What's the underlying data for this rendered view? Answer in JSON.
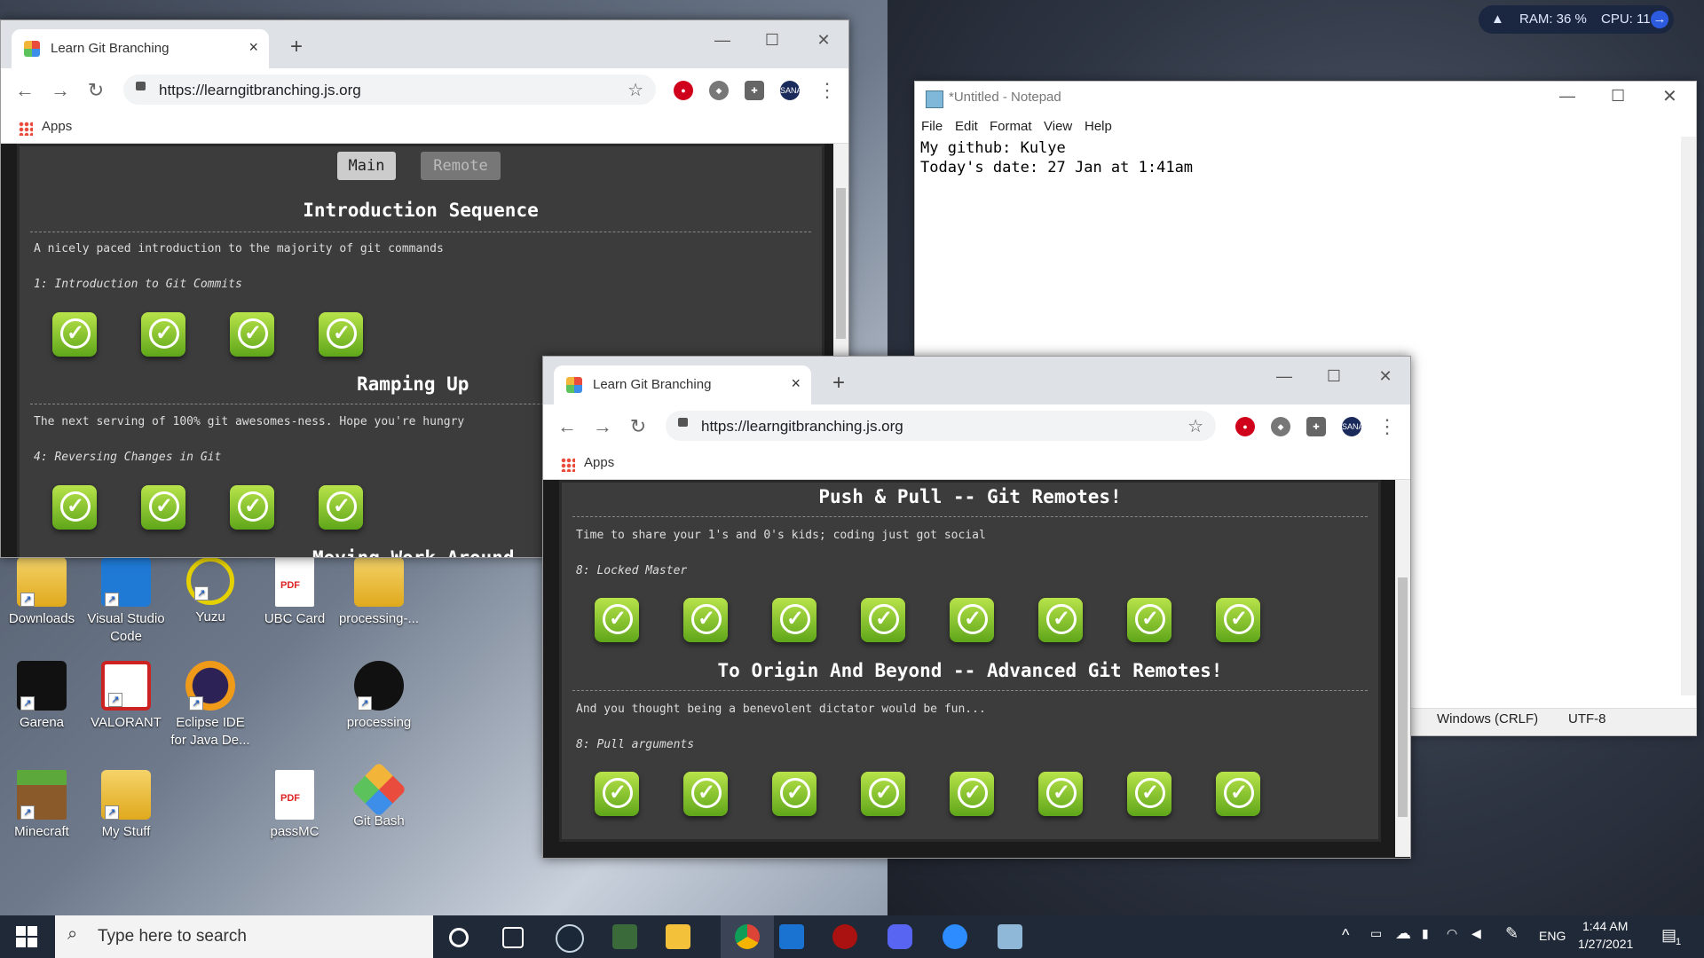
{
  "system_monitor": {
    "ram": "RAM: 36 %",
    "cpu": "CPU: 11 %"
  },
  "desktop_icons": [
    {
      "label": "Downloads"
    },
    {
      "label": "Visual Studio Code"
    },
    {
      "label": "Yuzu"
    },
    {
      "label": "UBC Card"
    },
    {
      "label": "processing-..."
    },
    {
      "label": "Garena"
    },
    {
      "label": "VALORANT"
    },
    {
      "label": "Eclipse IDE for Java De..."
    },
    {
      "label": "processing"
    },
    {
      "label": "Minecraft"
    },
    {
      "label": "My Stuff"
    },
    {
      "label": "passMC"
    },
    {
      "label": "Git Bash"
    }
  ],
  "browser1": {
    "tab_title": "Learn Git Branching",
    "url": "https://learngitbranching.js.org",
    "bookmark": "Apps",
    "tabs": [
      "Main",
      "Remote"
    ],
    "sections": [
      {
        "header": "Introduction Sequence",
        "desc": "A nicely paced introduction to the majority of git commands",
        "level": "1: Introduction to Git Commits"
      },
      {
        "header": "Ramping Up",
        "desc": "The next serving of 100% git awesomes-ness. Hope you're hungry",
        "level": "4: Reversing Changes in Git"
      },
      {
        "header": "Moving Work Around"
      }
    ]
  },
  "browser2": {
    "tab_title": "Learn Git Branching",
    "url": "https://learngitbranching.js.org",
    "bookmark": "Apps",
    "sections": [
      {
        "header": "Push & Pull -- Git Remotes!",
        "desc": "Time to share your 1's and 0's kids; coding just got social",
        "level": "8: Locked Master"
      },
      {
        "header": "To Origin And Beyond -- Advanced Git Remotes!",
        "desc": "And you thought being a benevolent dictator would be fun...",
        "level": "8: Pull arguments"
      }
    ]
  },
  "notepad": {
    "title": "*Untitled - Notepad",
    "menu": [
      "File",
      "Edit",
      "Format",
      "View",
      "Help"
    ],
    "line1": "My github: Kulye",
    "line2": "Today's date: 27 Jan at 1:41am",
    "line_ending": "Windows (CRLF)",
    "encoding": "UTF-8"
  },
  "taskbar": {
    "search_placeholder": "Type here to search",
    "lang": "ENG",
    "time": "1:44 AM",
    "date": "1/27/2021",
    "notifications": "1"
  }
}
